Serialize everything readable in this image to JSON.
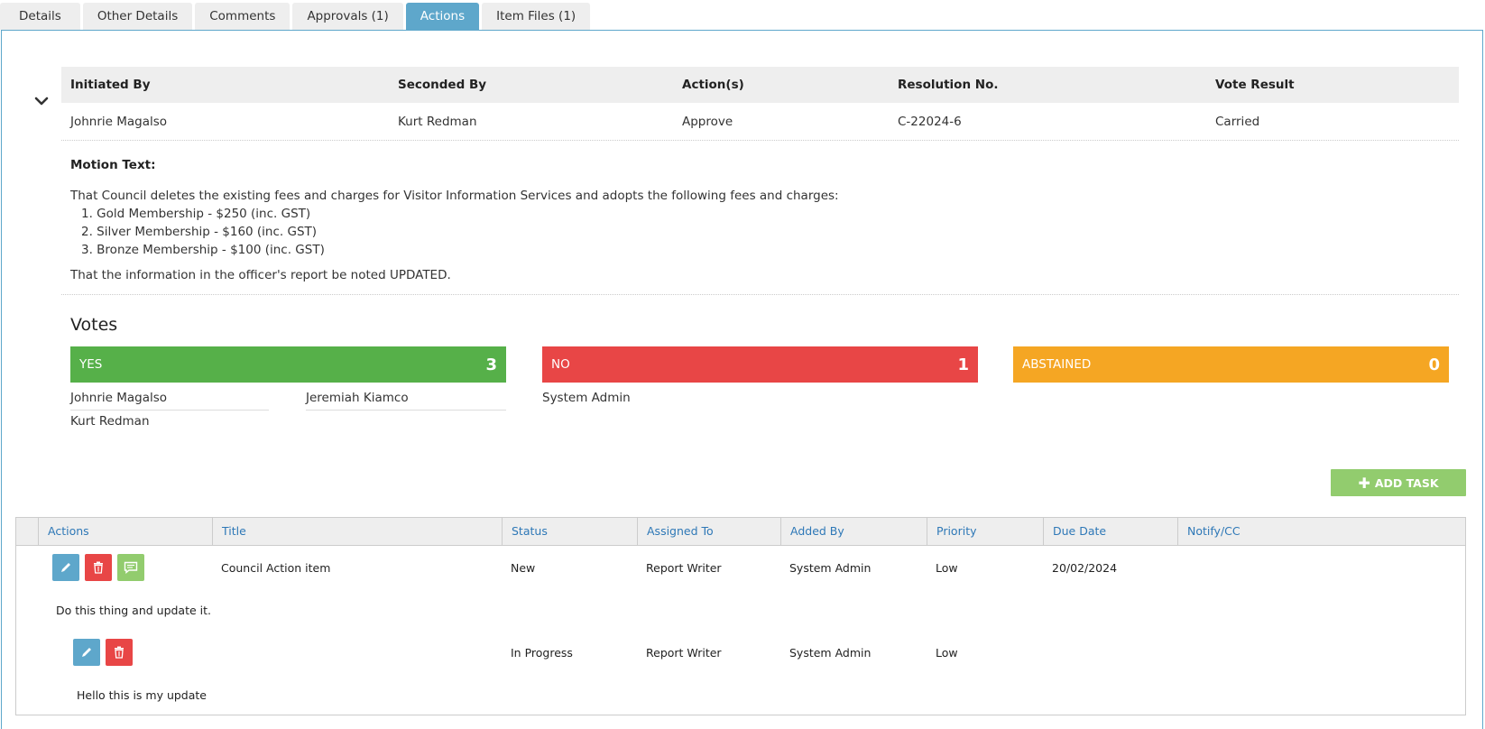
{
  "tabs": [
    {
      "label": "Details"
    },
    {
      "label": "Other Details"
    },
    {
      "label": "Comments"
    },
    {
      "label": "Approvals (1)"
    },
    {
      "label": "Actions"
    },
    {
      "label": "Item Files (1)"
    }
  ],
  "motion": {
    "headers": {
      "initiated_by": "Initiated By",
      "seconded_by": "Seconded By",
      "actions": "Action(s)",
      "resolution_no": "Resolution No.",
      "vote_result": "Vote Result"
    },
    "row": {
      "initiated_by": "Johnrie Magalso",
      "seconded_by": "Kurt Redman",
      "actions": "Approve",
      "resolution_no": "C-22024-6",
      "vote_result": "Carried"
    },
    "text_label": "Motion Text:",
    "text_intro": "That Council deletes the existing fees and charges for Visitor Information Services and adopts the following fees and charges:",
    "text_items": [
      "1. Gold Membership - $250 (inc. GST)",
      "2. Silver Membership - $160 (inc. GST)",
      "3. Bronze Membership - $100 (inc. GST)"
    ],
    "text_note": "That the information in the officer's report be noted UPDATED."
  },
  "votes": {
    "title": "Votes",
    "yes": {
      "label": "YES",
      "count": "3",
      "color": "#56b049",
      "voters": [
        "Johnrie Magalso",
        "Jeremiah Kiamco",
        "Kurt Redman"
      ]
    },
    "no": {
      "label": "NO",
      "count": "1",
      "color": "#e84646",
      "voters": [
        "System Admin"
      ]
    },
    "abstained": {
      "label": "ABSTAINED",
      "count": "0",
      "color": "#f5a623",
      "voters": []
    }
  },
  "add_task_label": "ADD TASK",
  "task_grid": {
    "headers": [
      "Actions",
      "Title",
      "Status",
      "Assigned To",
      "Added By",
      "Priority",
      "Due Date",
      "Notify/CC"
    ],
    "tasks": [
      {
        "title": "Council Action item",
        "status": "New",
        "assigned_to": "Report Writer",
        "added_by": "System Admin",
        "priority": "Low",
        "due_date": "20/02/2024",
        "notify_cc": "",
        "description": "Do this thing and update it."
      }
    ],
    "updates": [
      {
        "status": "In Progress",
        "assigned_to": "Report Writer",
        "added_by": "System Admin",
        "priority": "Low",
        "description": "Hello this is my update"
      }
    ]
  },
  "colors": {
    "accent": "#5ea7cb",
    "header_link": "#2e78b7",
    "add_task": "#92cc6e"
  }
}
